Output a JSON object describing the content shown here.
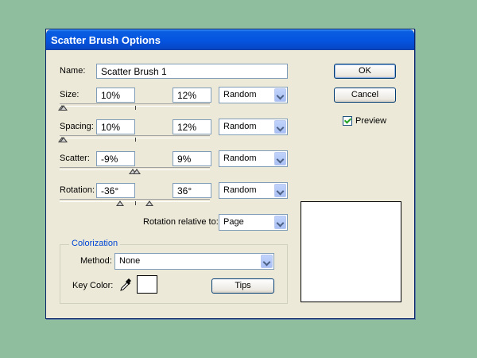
{
  "dialog": {
    "title": "Scatter Brush Options",
    "name": {
      "label": "Name:",
      "value": "Scatter Brush 1"
    },
    "rows": {
      "size": {
        "label": "Size:",
        "min": "10%",
        "max": "12%",
        "method": "Random"
      },
      "spacing": {
        "label": "Spacing:",
        "min": "10%",
        "max": "12%",
        "method": "Random"
      },
      "scatter": {
        "label": "Scatter:",
        "min": "-9%",
        "max": "9%",
        "method": "Random"
      },
      "rotation": {
        "label": "Rotation:",
        "min": "-36°",
        "max": "36°",
        "method": "Random"
      }
    },
    "rotation_relative": {
      "label": "Rotation relative to:",
      "value": "Page"
    },
    "colorization": {
      "legend": "Colorization",
      "method_label": "Method:",
      "method_value": "None",
      "key_color_label": "Key Color:",
      "tips_label": "Tips"
    },
    "buttons": {
      "ok": "OK",
      "cancel": "Cancel"
    },
    "preview": {
      "label": "Preview",
      "checked": true
    }
  }
}
